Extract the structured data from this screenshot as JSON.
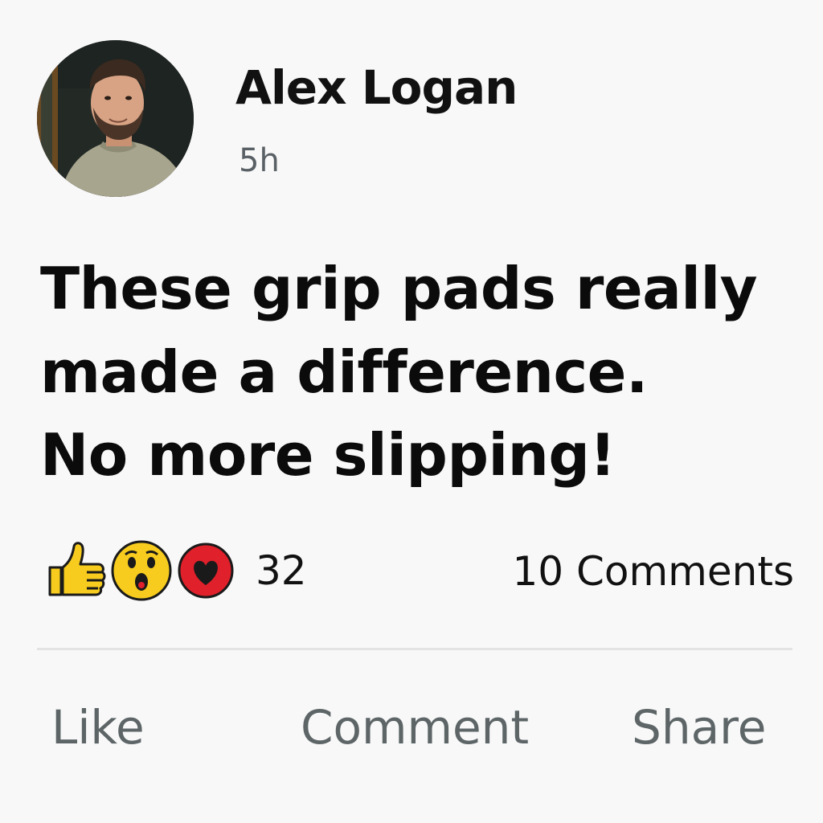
{
  "post": {
    "author": "Alex Logan",
    "time": "5h",
    "text_lines": [
      "These grip pads really",
      "made a difference.",
      "No more slipping!"
    ]
  },
  "reactions": {
    "icons": [
      "thumbs-up-icon",
      "wow-face-icon",
      "heart-icon"
    ],
    "count": "32"
  },
  "comments": {
    "label": "10 Comments"
  },
  "actions": {
    "like": "Like",
    "comment": "Comment",
    "share": "Share"
  },
  "colors": {
    "background": "#f8f8f8",
    "text": "#111111",
    "muted": "#5d6567",
    "like_yellow": "#f7cc1e",
    "heart_red": "#e0202a"
  }
}
